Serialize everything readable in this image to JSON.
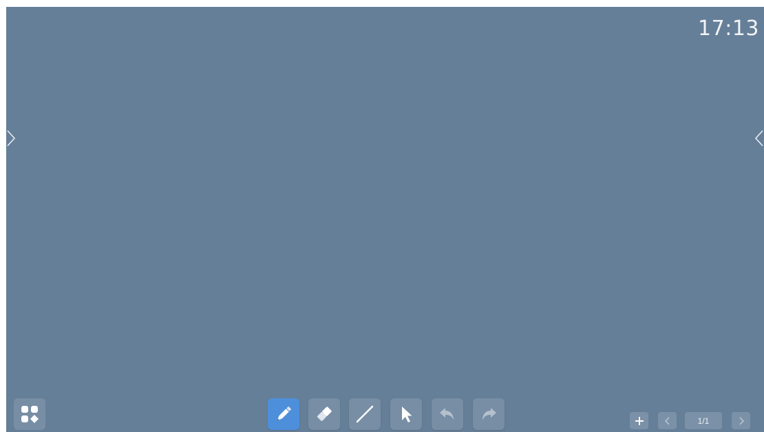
{
  "status": {
    "clock": "17:13"
  },
  "side_panels": {
    "left_toggle_icon": "chevron-right-icon",
    "right_toggle_icon": "chevron-left-icon"
  },
  "toolbar": {
    "apps_icon": "apps-grid-icon",
    "tools": [
      {
        "name": "pen",
        "icon": "pencil-icon",
        "active": true
      },
      {
        "name": "eraser",
        "icon": "eraser-icon",
        "active": false
      },
      {
        "name": "line",
        "icon": "line-icon",
        "active": false
      },
      {
        "name": "select",
        "icon": "cursor-icon",
        "active": false
      },
      {
        "name": "undo",
        "icon": "undo-icon",
        "enabled": false
      },
      {
        "name": "redo",
        "icon": "redo-icon",
        "enabled": false
      }
    ]
  },
  "pagination": {
    "add_icon": "plus-icon",
    "prev_icon": "chevron-left-icon",
    "next_icon": "chevron-right-icon",
    "page_indicator": "1/1"
  },
  "colors": {
    "background": "#667f98",
    "button": "#778ea5",
    "active_button": "#4e8fdb"
  }
}
